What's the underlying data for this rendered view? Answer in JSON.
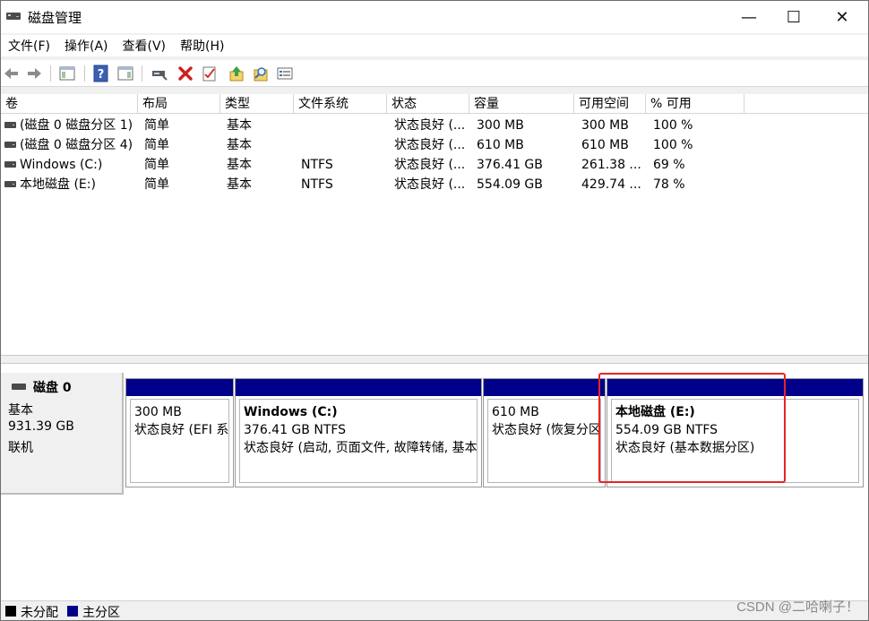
{
  "window": {
    "title": "磁盘管理",
    "minimize_glyph": "—",
    "maximize_glyph": "☐",
    "close_glyph": "✕"
  },
  "menu": [
    "文件(F)",
    "操作(A)",
    "查看(V)",
    "帮助(H)"
  ],
  "toolbar": {
    "icons": [
      "back-arrow-icon",
      "forward-arrow-icon",
      "console-tree-icon",
      "help-icon",
      "properties-icon",
      "connect-icon",
      "delete-icon",
      "check-icon",
      "up-arrow-icon",
      "search-icon",
      "list-icon"
    ],
    "delete_color": "#d01e1e"
  },
  "volume_list": {
    "columns": [
      "卷",
      "布局",
      "类型",
      "文件系统",
      "状态",
      "容量",
      "可用空间",
      "% 可用"
    ],
    "rows": [
      [
        "(磁盘 0 磁盘分区 1)",
        "简单",
        "基本",
        "",
        "状态良好 (...",
        "300 MB",
        "300 MB",
        "100 %"
      ],
      [
        "(磁盘 0 磁盘分区 4)",
        "简单",
        "基本",
        "",
        "状态良好 (...",
        "610 MB",
        "610 MB",
        "100 %"
      ],
      [
        "Windows (C:)",
        "简单",
        "基本",
        "NTFS",
        "状态良好 (...",
        "376.41 GB",
        "261.38 ...",
        "69 %"
      ],
      [
        "本地磁盘 (E:)",
        "简单",
        "基本",
        "NTFS",
        "状态良好 (...",
        "554.09 GB",
        "429.74 ...",
        "78 %"
      ]
    ]
  },
  "disk": {
    "name": "磁盘 0",
    "type": "基本",
    "size": "931.39 GB",
    "state": "联机",
    "partitions": [
      {
        "title": "",
        "size": "300 MB",
        "status": "状态良好 (EFI 系"
      },
      {
        "title": "Windows  (C:)",
        "size": "376.41 GB NTFS",
        "status": "状态良好 (启动, 页面文件, 故障转储, 基本"
      },
      {
        "title": "",
        "size": "610 MB",
        "status": "状态良好 (恢复分区)"
      },
      {
        "title": "本地磁盘  (E:)",
        "size": "554.09 GB NTFS",
        "status": "状态良好 (基本数据分区)"
      }
    ],
    "bar_color": "#00008b",
    "highlight_color": "#e52525"
  },
  "legend": [
    {
      "label": "未分配",
      "color": "#000000"
    },
    {
      "label": "主分区",
      "color": "#00008b"
    }
  ],
  "watermark": "CSDN @二哈喇子！"
}
